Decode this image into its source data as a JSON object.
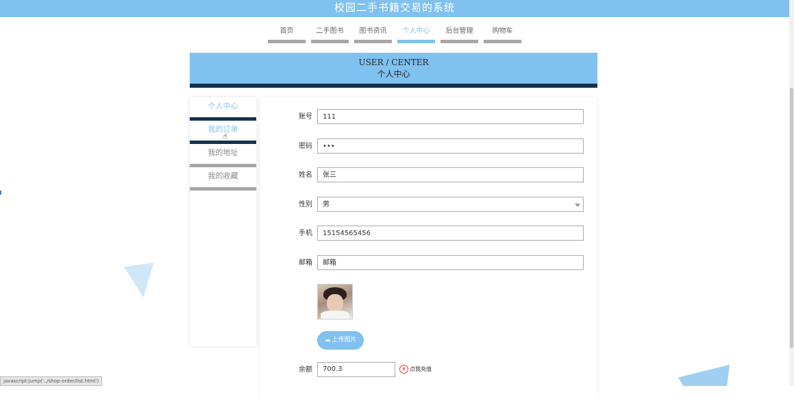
{
  "header": {
    "title": "校园二手书籍交易的系统"
  },
  "nav": {
    "items": [
      {
        "label": "首页",
        "active": false
      },
      {
        "label": "二手图书",
        "active": false
      },
      {
        "label": "图书资讯",
        "active": false
      },
      {
        "label": "个人中心",
        "active": true
      },
      {
        "label": "后台管理",
        "active": false
      },
      {
        "label": "购物车",
        "active": false
      }
    ]
  },
  "banner": {
    "en": "USER / CENTER",
    "zh": "个人中心"
  },
  "sidebar": {
    "items": [
      {
        "label": "个人中心"
      },
      {
        "label": "我的订单"
      },
      {
        "label": "我的地址"
      },
      {
        "label": "我的收藏"
      }
    ]
  },
  "form": {
    "account": {
      "label": "账号",
      "value": "111"
    },
    "password": {
      "label": "密码",
      "value": "•••"
    },
    "name": {
      "label": "姓名",
      "value": "张三"
    },
    "gender": {
      "label": "性别",
      "value": "男"
    },
    "phone": {
      "label": "手机",
      "value": "15154565456"
    },
    "email": {
      "label": "邮箱",
      "value": "邮箱"
    },
    "upload_label": "上传图片",
    "balance": {
      "label": "余额",
      "value": "700.3"
    },
    "recharge_label": "点我充值"
  },
  "status_bar": {
    "text": "javascript:jump('../shop-order/list.html')"
  },
  "colors": {
    "accent": "#7fc1ef",
    "dark": "#13324f",
    "inactive": "#a6a6a6"
  }
}
